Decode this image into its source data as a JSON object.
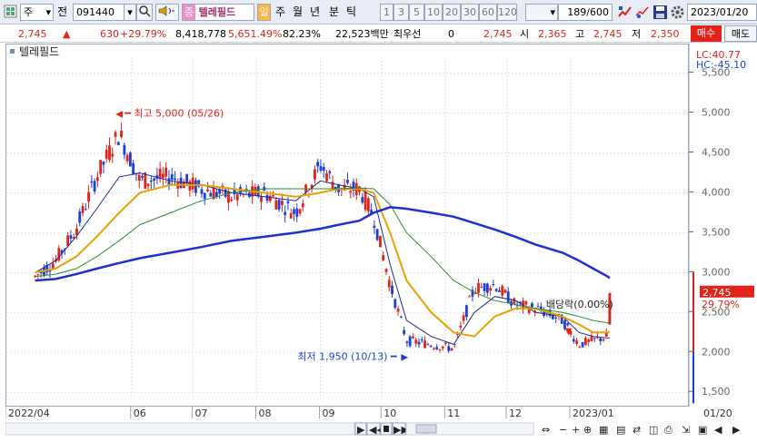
{
  "toolbar": {
    "market_mode": "주",
    "prev_label": "전",
    "code": "091440",
    "stock_badge": "종",
    "stock_name": "텔레필드",
    "period_day": "일",
    "period_week": "주",
    "period_month": "월",
    "period_year": "년",
    "period_min": "분",
    "period_tick": "틱",
    "intervals": [
      "1",
      "3",
      "5",
      "10",
      "20",
      "30",
      "60",
      "120"
    ],
    "count_value": "189",
    "count_total": "/600",
    "date": "2023/01/20"
  },
  "quote": {
    "price": "2,745",
    "change": "630",
    "change_pct": "+29.79%",
    "volume": "8,418,778",
    "volume_pct": "5,651.49%",
    "turnover_pct": "82.23%",
    "amount": "22,523백만",
    "priority_label": "최우선",
    "priority_value": "0",
    "priority_price": "2,745",
    "open_label": "시",
    "open": "2,365",
    "high_label": "고",
    "high": "2,745",
    "low_label": "저",
    "low": "2,350",
    "buy_label": "매수",
    "sell_label": "매도"
  },
  "chart_data": {
    "type": "line",
    "title": "텔레필드",
    "series": [
      {
        "name": "price",
        "x": [
          "2022-04-15",
          "2022-04-25",
          "2022-05-05",
          "2022-05-15",
          "2022-05-26",
          "2022-06-05",
          "2022-06-20",
          "2022-07-05",
          "2022-07-20",
          "2022-08-05",
          "2022-08-20",
          "2022-09-01",
          "2022-09-10",
          "2022-09-20",
          "2022-09-27",
          "2022-10-05",
          "2022-10-13",
          "2022-10-25",
          "2022-11-05",
          "2022-11-15",
          "2022-11-25",
          "2022-12-05",
          "2022-12-15",
          "2022-12-28",
          "2023-01-05",
          "2023-01-12",
          "2023-01-19",
          "2023-01-20"
        ],
        "values": [
          2950,
          3150,
          3550,
          4200,
          4750,
          4150,
          4200,
          4050,
          3950,
          4000,
          3750,
          4350,
          4050,
          4050,
          3700,
          2850,
          2150,
          2100,
          2050,
          2800,
          2850,
          2600,
          2550,
          2400,
          2100,
          2150,
          2200,
          2745
        ]
      }
    ],
    "moving_averages": [
      {
        "values": [
          3000,
          3150,
          3450,
          3800,
          4200,
          4250,
          4150,
          4100,
          4000,
          3950,
          3900,
          4150,
          4100,
          4050,
          3950,
          3100,
          2400,
          2200,
          2100,
          2500,
          2700,
          2650,
          2500,
          2450,
          2250,
          2200,
          2180,
          2180
        ]
      },
      {
        "values": [
          3000,
          3050,
          3200,
          3450,
          3750,
          4000,
          4100,
          4100,
          4050,
          4000,
          3950,
          4000,
          4050,
          4050,
          4000,
          3500,
          2900,
          2500,
          2250,
          2200,
          2450,
          2550,
          2550,
          2450,
          2350,
          2250,
          2250,
          2260
        ]
      },
      {
        "values": [
          2950,
          2980,
          3050,
          3200,
          3400,
          3600,
          3750,
          3900,
          4000,
          4050,
          4050,
          4050,
          4050,
          4060,
          4050,
          3850,
          3500,
          3200,
          2900,
          2750,
          2650,
          2600,
          2550,
          2500,
          2450,
          2400,
          2370,
          2350
        ]
      },
      {
        "values": [
          2900,
          2920,
          2980,
          3050,
          3120,
          3180,
          3250,
          3320,
          3400,
          3450,
          3500,
          3550,
          3600,
          3650,
          3750,
          3820,
          3800,
          3750,
          3700,
          3620,
          3540,
          3450,
          3350,
          3250,
          3150,
          3050,
          2950,
          2930
        ]
      }
    ],
    "annotations": [
      {
        "text": "최고 5,000 (05/26)"
      },
      {
        "text": "최저 1,950 (10/13)"
      },
      {
        "text": "배당락(0.00%)"
      }
    ],
    "ylim": [
      1400,
      5700
    ],
    "yticks": [
      1500,
      2000,
      2500,
      3000,
      3500,
      4000,
      4500,
      5000,
      5500
    ],
    "ytick_labels": [
      "1,500",
      "2,000",
      "2,500",
      "3,000",
      "3,500",
      "4,000",
      "4,500",
      "5,000",
      "5,500"
    ],
    "xtick_labels": [
      "2022/04",
      "06",
      "07",
      "08",
      "09",
      "10",
      "11",
      "12",
      "2023/01"
    ],
    "xticks": [
      "2022-04-01",
      "2022-06-01",
      "2022-07-01",
      "2022-08-01",
      "2022-09-01",
      "2022-10-01",
      "2022-11-01",
      "2022-12-01",
      "2023-01-01"
    ],
    "xlim": [
      "2022-04-01",
      "2023-02-28"
    ],
    "lc_label": "LC:40.77",
    "hc_label": "HC:-45.10",
    "last_price_label": "2,745",
    "last_pct_label": "29.79%",
    "next_month_label": "01/20",
    "colors": {
      "up": "#e2231a",
      "down": "#1d3fd6",
      "ma5": "#1d2c8f",
      "ma20": "#e8a200",
      "ma60": "#2e8b3a",
      "ma120": "#1f2fd0"
    }
  },
  "icons": [
    "dropdown-icon",
    "search-icon",
    "speaker-icon",
    "chart-tool-icon",
    "save-icon",
    "settings-icon",
    "calendar-icon"
  ]
}
